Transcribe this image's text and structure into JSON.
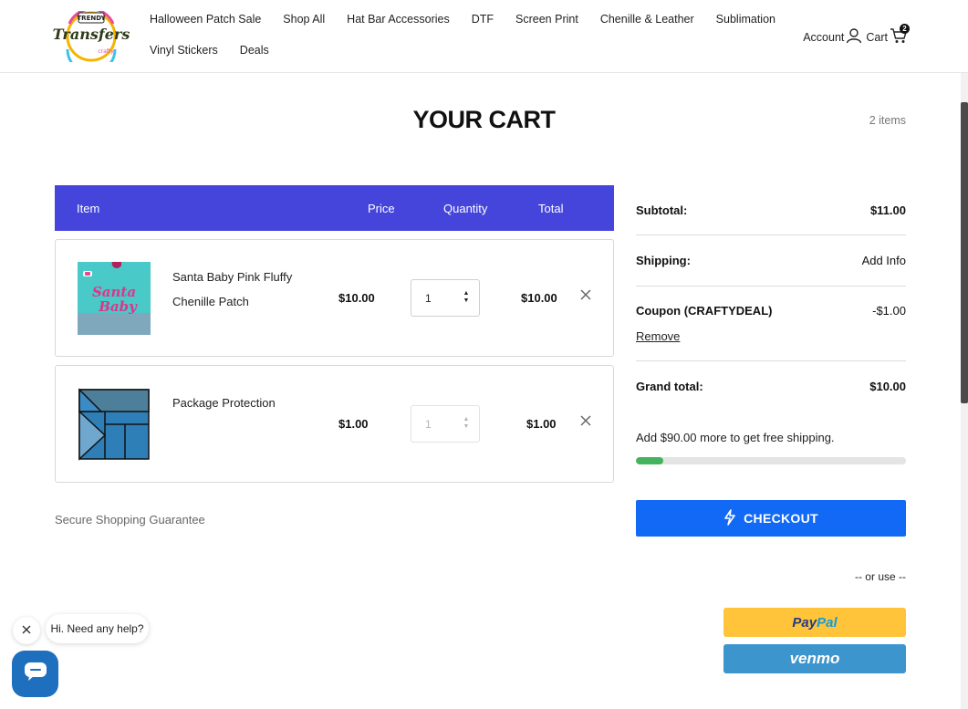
{
  "header": {
    "logo_text": "Trendy Transfers",
    "nav_row1": [
      "Halloween Patch Sale",
      "Shop All",
      "Hat Bar Accessories",
      "DTF",
      "Screen Print",
      "Chenille & Leather",
      "Sublimation"
    ],
    "nav_row2": [
      "Vinyl Stickers",
      "Deals"
    ],
    "account_label": "Account",
    "cart_label": "Cart",
    "cart_count": "2"
  },
  "page": {
    "title": "YOUR CART",
    "items_count": "2 items"
  },
  "table": {
    "headers": {
      "item": "Item",
      "price": "Price",
      "quantity": "Quantity",
      "total": "Total"
    },
    "rows": [
      {
        "name": "Santa Baby Pink Fluffy Chenille Patch",
        "price": "$10.00",
        "qty": "1",
        "total": "$10.00",
        "image_icon": "santa-baby-patch-image",
        "qty_disabled": false
      },
      {
        "name": "Package Protection",
        "price": "$1.00",
        "qty": "1",
        "total": "$1.00",
        "image_icon": "package-protection-image",
        "qty_disabled": true
      }
    ]
  },
  "secure_text": "Secure Shopping Guarantee",
  "summary": {
    "subtotal_label": "Subtotal:",
    "subtotal_value": "$11.00",
    "shipping_label": "Shipping:",
    "shipping_value": "Add Info",
    "coupon_label": "Coupon (CRAFTYDEAL)",
    "coupon_value": "-$1.00",
    "coupon_remove": "Remove",
    "grand_label": "Grand total:",
    "grand_value": "$10.00",
    "free_shipping_text": "Add $90.00 more to get free shipping.",
    "free_shipping_progress": 0.1
  },
  "checkout_label": "CHECKOUT",
  "or_use_text": "-- or use --",
  "paypal": {
    "part1": "Pay",
    "part2": "Pal"
  },
  "venmo_label": "venmo",
  "chat": {
    "bubble_text": "Hi. Need any help?"
  },
  "colors": {
    "table_header": "#4545dc",
    "checkout": "#1269f5",
    "paypal": "#ffc43a",
    "venmo": "#3d95ce",
    "progress_fill": "#44b35d",
    "chat_button": "#1f6fbf"
  }
}
